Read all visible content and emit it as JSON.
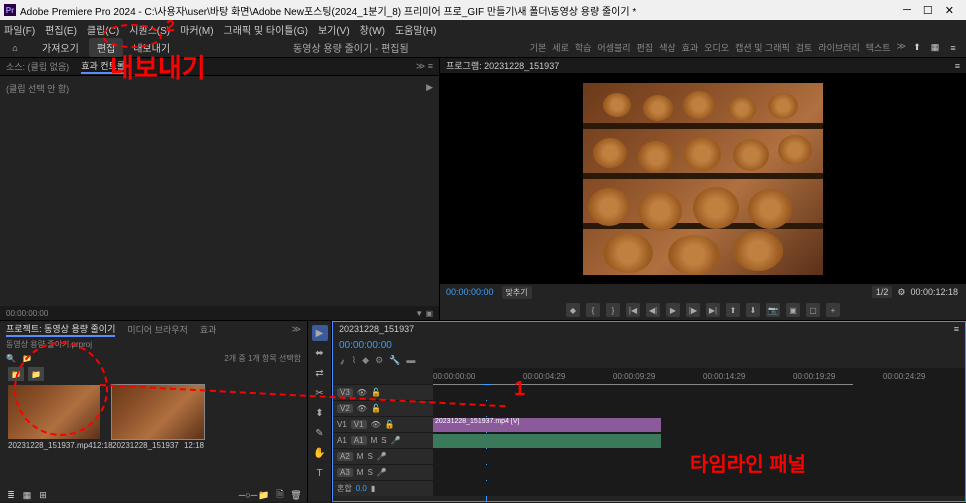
{
  "titlebar": {
    "app": "Pr",
    "title": "Adobe Premiere Pro 2024 - C:\\사용자\\user\\바탕 화면\\Adobe New포스팅(2024_1분기_8) 프리미어 프로_GIF 만들기\\새 폴더\\동영상 용량 줄이기 *"
  },
  "menubar": [
    "파일(F)",
    "편집(E)",
    "클립(C)",
    "시퀀스(S)",
    "마커(M)",
    "그래픽 및 타이틀(G)",
    "보기(V)",
    "창(W)",
    "도움말(H)"
  ],
  "wsrow": {
    "tabs": [
      "가져오기",
      "편집",
      "내보내기"
    ],
    "center": "동영상 용량 줄이기 - 편집됨",
    "wsbtns": [
      "기본",
      "세로",
      "학습",
      "어셈블리",
      "편집",
      "색상",
      "효과",
      "오디오",
      "캡션 및 그래픽",
      "검토",
      "라이브러리",
      "텍스트"
    ]
  },
  "source": {
    "tabs": [
      "소스: (클립 없음)",
      "효과 컨트롤"
    ],
    "body_label": "(클립 선택 안 함)",
    "tc": "00:00:00:00"
  },
  "program": {
    "title": "프로그램: 20231228_151937",
    "tc_left": "00:00:00:00",
    "fit": "맞추기",
    "zoom": "1/2",
    "tc_right": "00:00:12:18"
  },
  "project": {
    "tabs": [
      "프로젝트: 동영상 용량 줄이기",
      "미디어 브라우저",
      "효과"
    ],
    "file": "동영상 용량 줄이기.prproj",
    "count": "2개 중 1개 항목 선택함",
    "clips": [
      {
        "name": "20231228_151937.mp4",
        "dur": "12:18"
      },
      {
        "name": "20231228_151937",
        "dur": "12:18"
      }
    ]
  },
  "timeline": {
    "seq": "20231228_151937",
    "tc": "00:00:00:00",
    "ticks": [
      "00:00:00:00",
      "00:00:04:29",
      "00:00:09:29",
      "00:00:14:29",
      "00:00:19:29",
      "00:00:24:29"
    ],
    "tracks_v": [
      "V3",
      "V2",
      "V1"
    ],
    "tracks_a": [
      "A1",
      "A2",
      "A3"
    ],
    "mix": "혼합",
    "mixval": "0.0",
    "clip_name": "20231228_151937.mp4 [V]"
  },
  "anno": {
    "num1": "1",
    "num2": "2",
    "export": "내보내기",
    "tl": "타임라인 패널"
  }
}
